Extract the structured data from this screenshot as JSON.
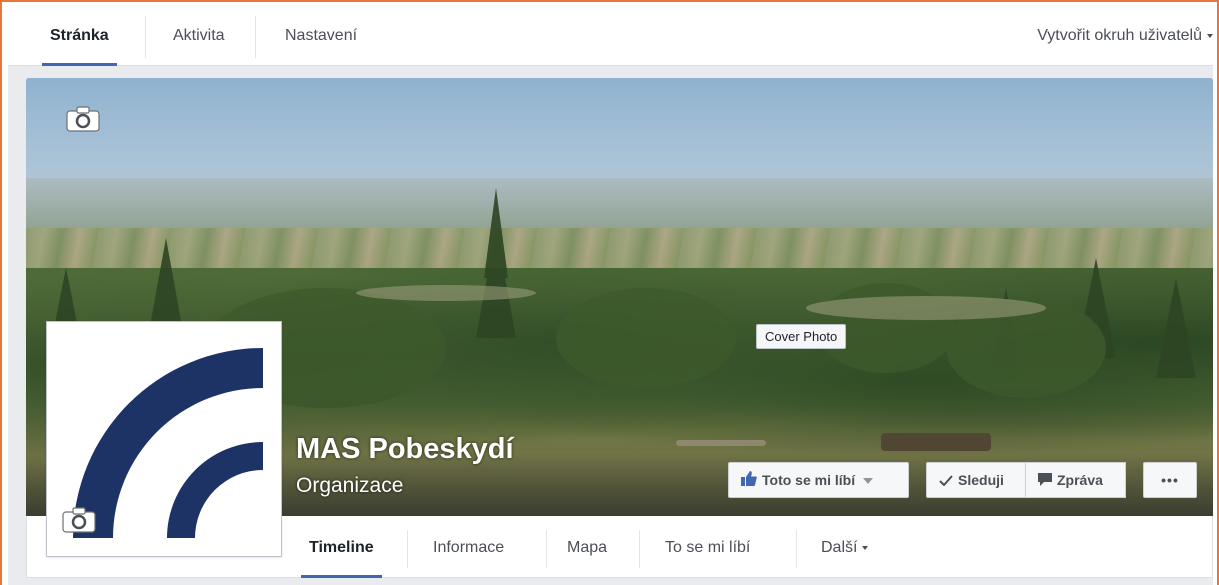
{
  "admin_nav": {
    "tabs": [
      {
        "label": "Stránka",
        "active": true
      },
      {
        "label": "Aktivita",
        "active": false
      },
      {
        "label": "Nastavení",
        "active": false
      }
    ],
    "create_audience_label": "Vytvořit okruh uživatelů"
  },
  "cover": {
    "tooltip": "Cover Photo",
    "camera_icon": "camera-icon"
  },
  "page": {
    "name": "MAS Pobeskydí",
    "category": "Organizace"
  },
  "actions": {
    "like_label": "Toto se mi líbí",
    "follow_label": "Sleduji",
    "message_label": "Zpráva",
    "more_label": "•••"
  },
  "page_nav": {
    "tabs": [
      {
        "label": "Timeline",
        "active": true
      },
      {
        "label": "Informace",
        "active": false
      },
      {
        "label": "Mapa",
        "active": false
      },
      {
        "label": "To se mi líbí",
        "active": false
      },
      {
        "label": "Další",
        "active": false
      }
    ]
  },
  "colors": {
    "accent": "#4267b2",
    "logo_navy": "#1d3366",
    "frame_border": "#e8753a"
  }
}
